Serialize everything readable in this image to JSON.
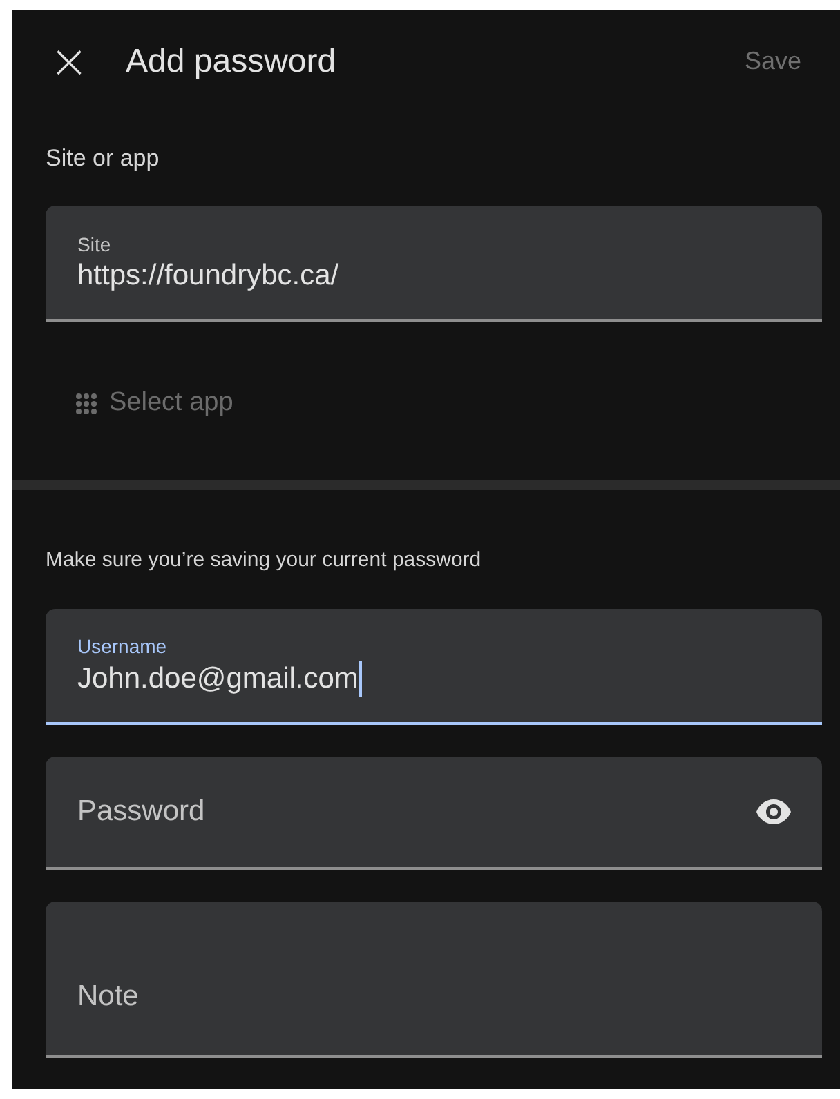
{
  "header": {
    "close_icon": "×",
    "title": "Add password",
    "save": {
      "label": "Save",
      "disabled": true
    }
  },
  "site_section": {
    "heading": "Site or app",
    "field": {
      "label": "Site",
      "value": "https://foundrybc.ca/",
      "focused": false
    },
    "select_app": {
      "label": "Select app",
      "disabled": true
    }
  },
  "credentials": {
    "hint": "Make sure you’re saving your current password",
    "fields": [
      {
        "kind": "text",
        "label": "Username",
        "value": "John.doe@gmail.com",
        "focused": true
      },
      {
        "kind": "password",
        "placeholder": "Password",
        "focused": false
      },
      {
        "kind": "note",
        "placeholder": "Note",
        "focused": false
      }
    ]
  }
}
